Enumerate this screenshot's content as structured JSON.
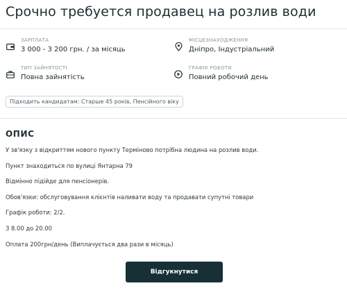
{
  "vacancy": {
    "title": "Срочно требуется продавец на розлив води"
  },
  "details": [
    {
      "key": "salary",
      "label": "ЗАРПЛАТА",
      "value": "3 000 - 3 200 грн. / за місяць",
      "icon": "wallet-icon"
    },
    {
      "key": "location",
      "label": "МІСЦЕЗНАХОДЖЕННЯ",
      "value": "Дніпро, Індустріальний",
      "icon": "location-pin-icon"
    },
    {
      "key": "employment",
      "label": "ТИП ЗАЙНЯТОСТІ",
      "value": "Повна зайнятість",
      "icon": "briefcase-icon"
    },
    {
      "key": "schedule",
      "label": "ГРАФІК РОБОТИ",
      "value": "Повний робочий день",
      "icon": "play-circle-icon"
    }
  ],
  "tag": "Підходить кандидатам: Старше 45 років, Пенсійного віку",
  "description": {
    "heading": "ОПИС",
    "paragraphs": [
      "У зв'язку з відкриттям нового пункту Терміново потрібна людина на розлив води.",
      "Пункт знаходиться по вулиці Янтарна 79",
      "Відмінно підійде для пенсіонерів.",
      "Обов'язки: обслуговування клієнтів наливати воду та продавати супутні товари",
      "Графік роботи: 2/2.",
      "З 8.00 до 20.00",
      "Оплата 200грн/день (Виплачується два рази в місяць)"
    ]
  },
  "actions": {
    "apply_label": "Відгукнутися"
  },
  "colors": {
    "button_bg": "#163035",
    "text": "#1d2b2f",
    "muted": "#8a9599",
    "separator": "#e3e6e8"
  }
}
